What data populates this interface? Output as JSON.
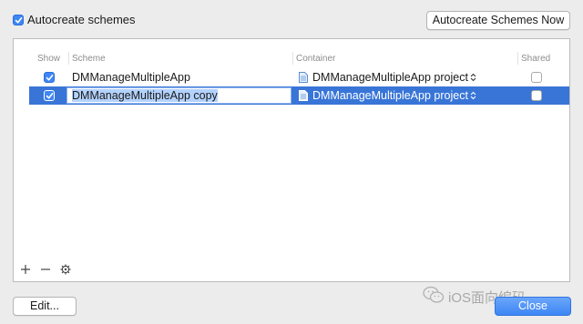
{
  "autocreate": {
    "label": "Autocreate schemes",
    "checked": true
  },
  "buttons": {
    "autocreate_now": "Autocreate Schemes Now",
    "edit": "Edit...",
    "close": "Close"
  },
  "table": {
    "headers": {
      "show": "Show",
      "scheme": "Scheme",
      "container": "Container",
      "shared": "Shared"
    },
    "rows": [
      {
        "show": true,
        "scheme": "DMManageMultipleApp",
        "container": "DMManageMultipleApp project",
        "shared": false,
        "selected": false
      },
      {
        "show": true,
        "scheme": "DMManageMultipleApp copy",
        "container": "DMManageMultipleApp project",
        "shared": false,
        "selected": true
      }
    ]
  },
  "watermark": {
    "text": "iOS面向编码"
  },
  "colors": {
    "accent": "#3875d7",
    "checkbox": "#3f86f5"
  }
}
